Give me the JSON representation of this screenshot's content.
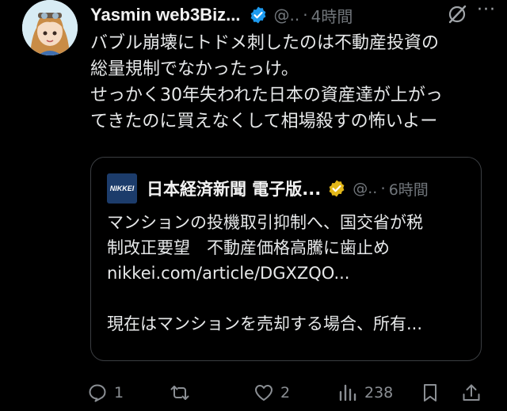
{
  "author": {
    "name": "Yasmin web3Biz...",
    "handle": "@..",
    "time": "4時間"
  },
  "tweet": {
    "lines": [
      "バブル崩壊にトドメ刺したのは不動産投資の",
      "総量規制でなかったっけ。",
      "せっかく30年失われた日本の資産達が上がっ",
      "てきたのに買えなくして相場殺すの怖いよー"
    ]
  },
  "quote": {
    "logo_text": "NIKKEI",
    "name": "日本経済新聞 電子版...",
    "handle": "@..",
    "time": "6時間",
    "lines": [
      "マンションの投機取引抑制へ、国交省が税",
      "制改正要望　不動産価格高騰に歯止め",
      "nikkei.com/article/DGXZQO...",
      "",
      "現在はマンションを売却する場合、所有..."
    ]
  },
  "actions": {
    "reply_count": "1",
    "retweet_count": "",
    "like_count": "2",
    "view_count": "238"
  },
  "colors": {
    "background": "#000000",
    "text": "#e7e9ea",
    "muted": "#71767b",
    "verified_blue": "#1d9bf0",
    "verified_gold": "#e2b719",
    "nikkei_blue": "#1c3c6b"
  },
  "icons": [
    "verified-badge-icon",
    "grok-icon",
    "more-icon",
    "reply-icon",
    "retweet-icon",
    "like-icon",
    "views-icon",
    "bookmark-icon",
    "share-icon"
  ]
}
